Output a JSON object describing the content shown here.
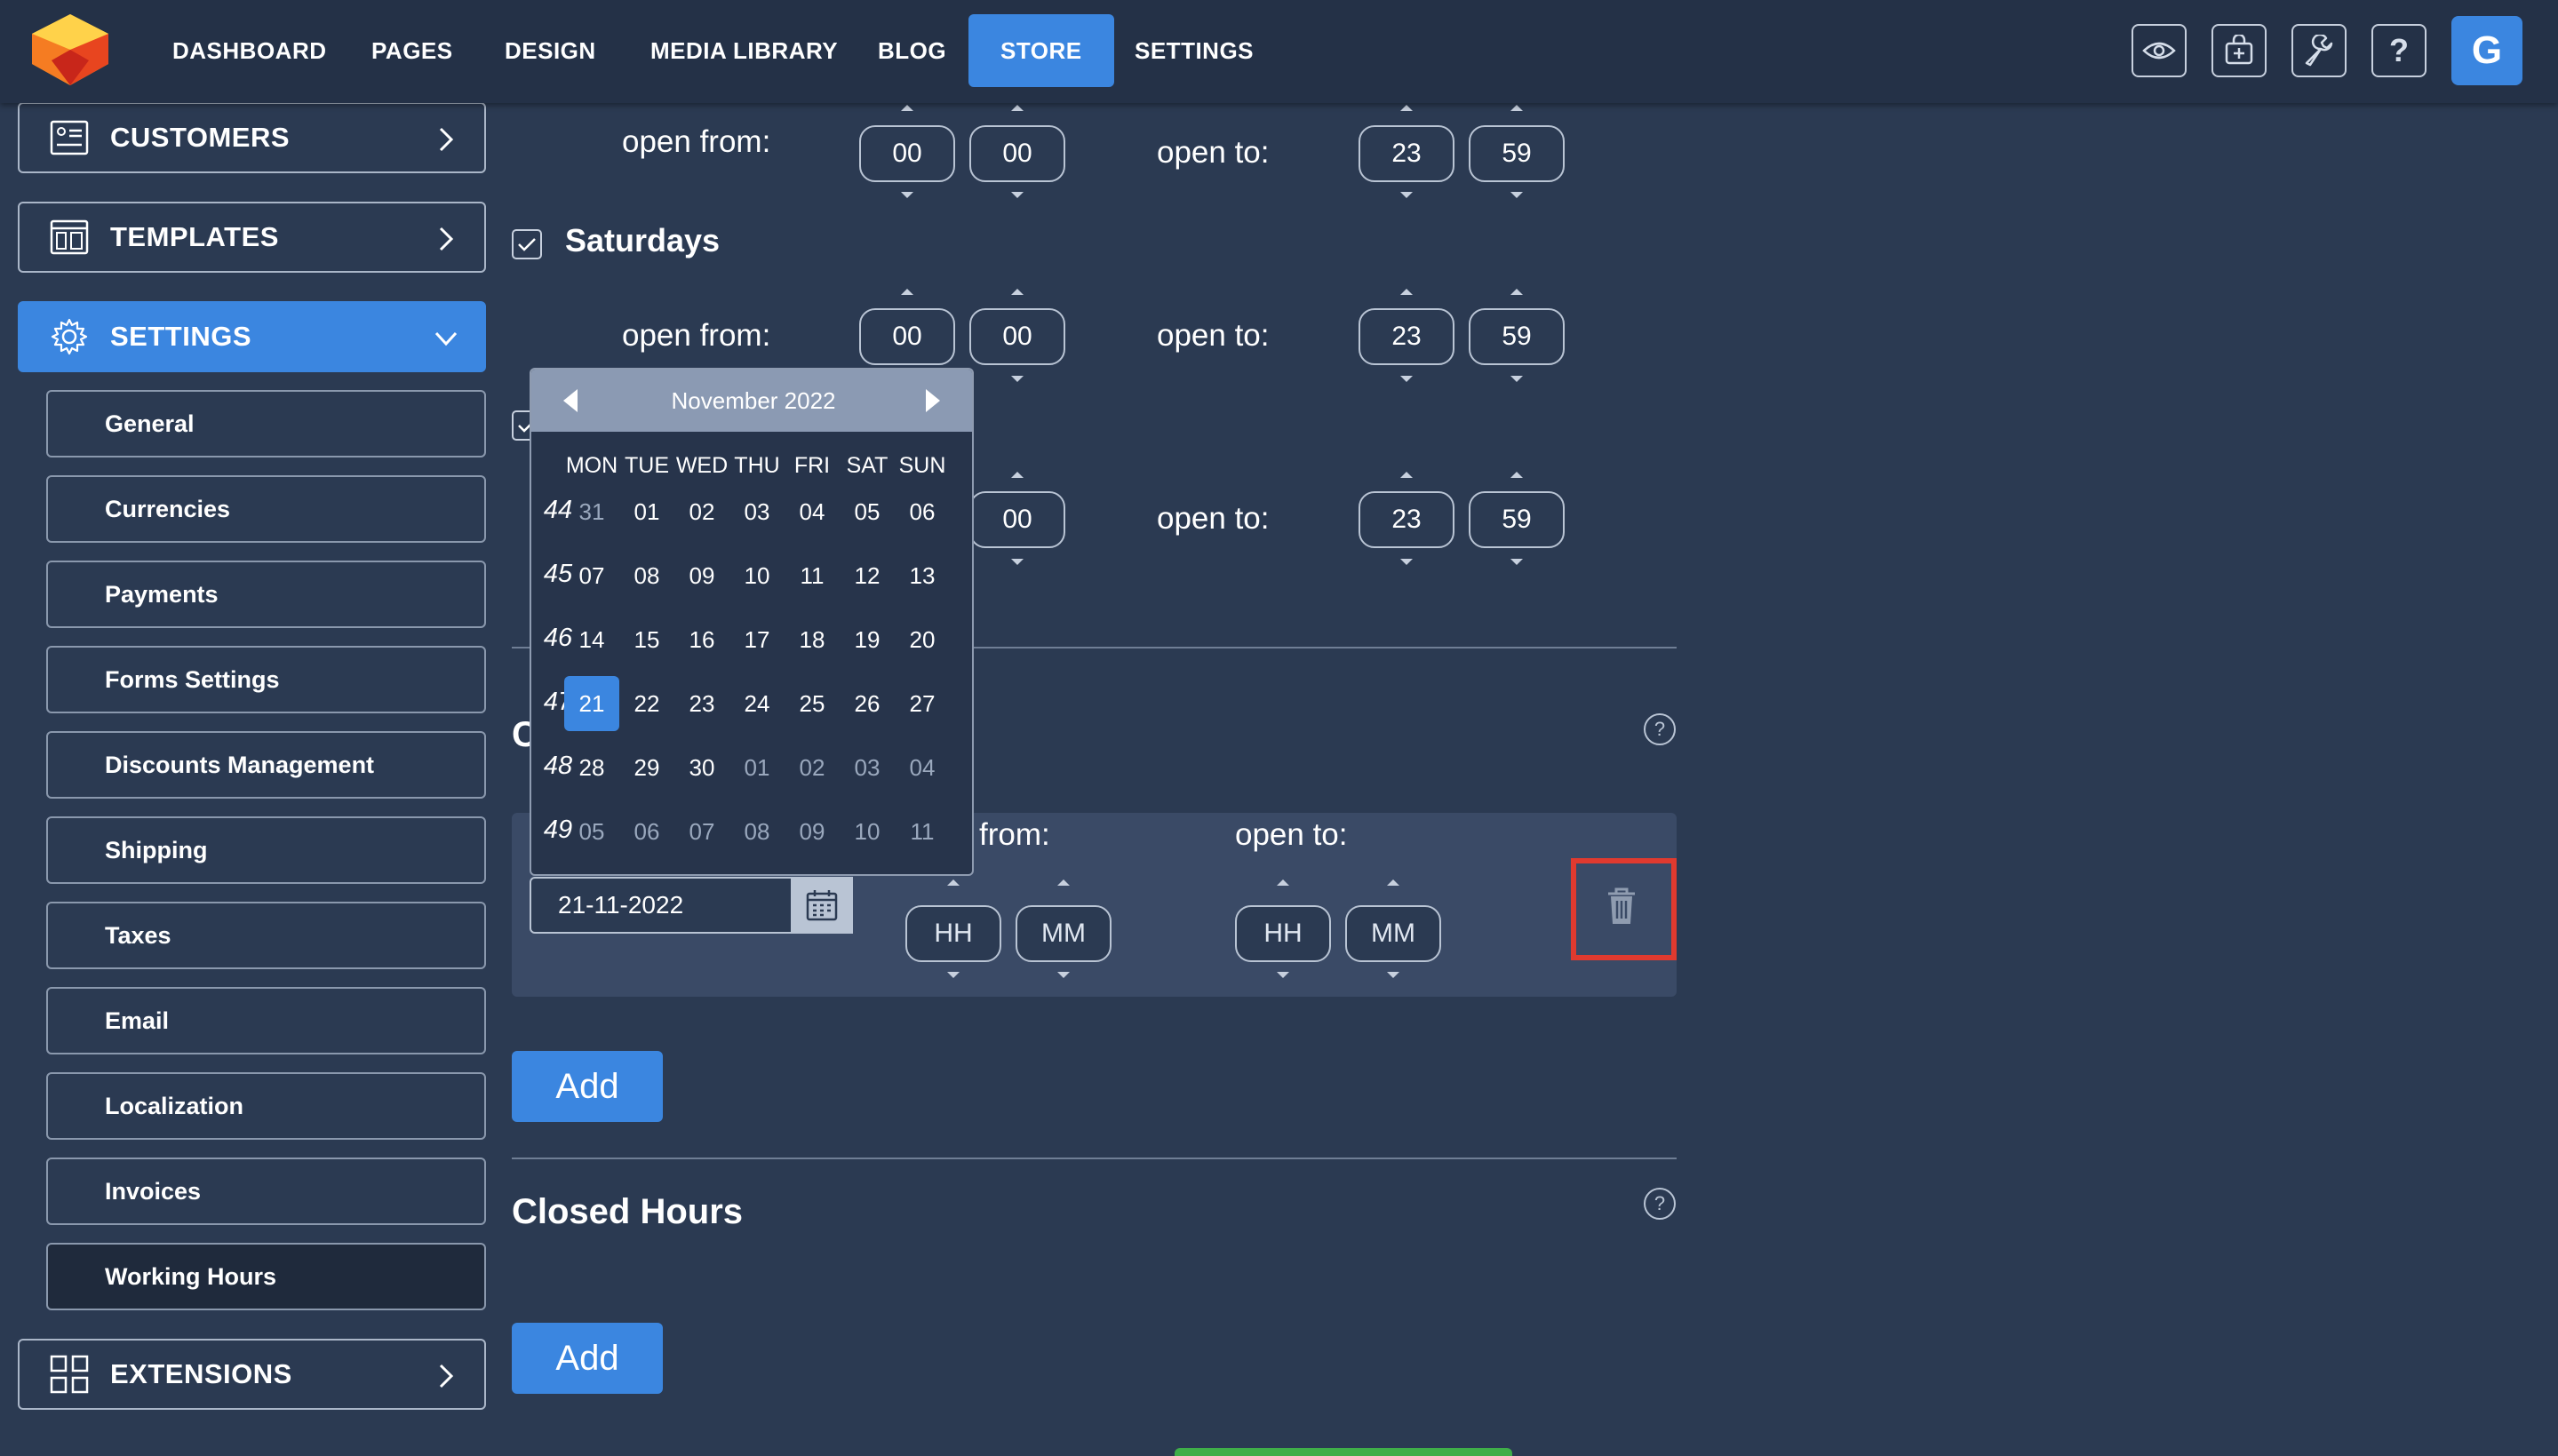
{
  "nav": {
    "items": [
      "DASHBOARD",
      "PAGES",
      "DESIGN",
      "MEDIA LIBRARY",
      "BLOG",
      "STORE",
      "SETTINGS"
    ],
    "active": "STORE",
    "avatar_letter": "G",
    "icons": [
      "eye-icon",
      "store-add-icon",
      "wrench-icon",
      "help-icon"
    ]
  },
  "sidebar": {
    "customers": "CUSTOMERS",
    "templates": "TEMPLATES",
    "settings": "SETTINGS",
    "extensions": "EXTENSIONS",
    "sub_items": [
      "General",
      "Currencies",
      "Payments",
      "Forms Settings",
      "Discounts Management",
      "Shipping",
      "Taxes",
      "Email",
      "Localization",
      "Invoices",
      "Working Hours"
    ],
    "active_sub": "Working Hours"
  },
  "working_hours": {
    "open_from": "open from:",
    "open_to": "open to:",
    "row1": {
      "from_h": "00",
      "from_m": "00",
      "to_h": "23",
      "to_m": "59"
    },
    "saturdays": "Saturdays",
    "row2": {
      "from_h": "00",
      "from_m": "00",
      "to_h": "23",
      "to_m": "59"
    },
    "row3": {
      "from_m": "00",
      "to_h": "23",
      "to_m": "59"
    }
  },
  "special": {
    "title_initial": "C",
    "from_label": "from:",
    "to_label": "open to:",
    "date_value": "21-11-2022",
    "hh": "HH",
    "mm": "MM",
    "add": "Add"
  },
  "closed_hours": {
    "title": "Closed Hours",
    "add": "Add"
  },
  "calendar": {
    "month": "November 2022",
    "dow": [
      "MON",
      "TUE",
      "WED",
      "THU",
      "FRI",
      "SAT",
      "SUN"
    ],
    "weeks": [
      {
        "num": "44",
        "days": [
          "31",
          "01",
          "02",
          "03",
          "04",
          "05",
          "06"
        ],
        "other": [
          true,
          false,
          false,
          false,
          false,
          false,
          false
        ]
      },
      {
        "num": "45",
        "days": [
          "07",
          "08",
          "09",
          "10",
          "11",
          "12",
          "13"
        ],
        "other": [
          false,
          false,
          false,
          false,
          false,
          false,
          false
        ]
      },
      {
        "num": "46",
        "days": [
          "14",
          "15",
          "16",
          "17",
          "18",
          "19",
          "20"
        ],
        "other": [
          false,
          false,
          false,
          false,
          false,
          false,
          false
        ]
      },
      {
        "num": "47",
        "days": [
          "21",
          "22",
          "23",
          "24",
          "25",
          "26",
          "27"
        ],
        "other": [
          false,
          false,
          false,
          false,
          false,
          false,
          false
        ]
      },
      {
        "num": "48",
        "days": [
          "28",
          "29",
          "30",
          "01",
          "02",
          "03",
          "04"
        ],
        "other": [
          false,
          false,
          false,
          true,
          true,
          true,
          true
        ]
      },
      {
        "num": "49",
        "days": [
          "05",
          "06",
          "07",
          "08",
          "09",
          "10",
          "11"
        ],
        "other": [
          true,
          true,
          true,
          true,
          true,
          true,
          true
        ]
      }
    ],
    "selected": "21"
  },
  "colors": {
    "accent": "#3b86e0",
    "background": "#2b3a52",
    "topbar": "#243147",
    "highlight": "#e03a2f"
  }
}
